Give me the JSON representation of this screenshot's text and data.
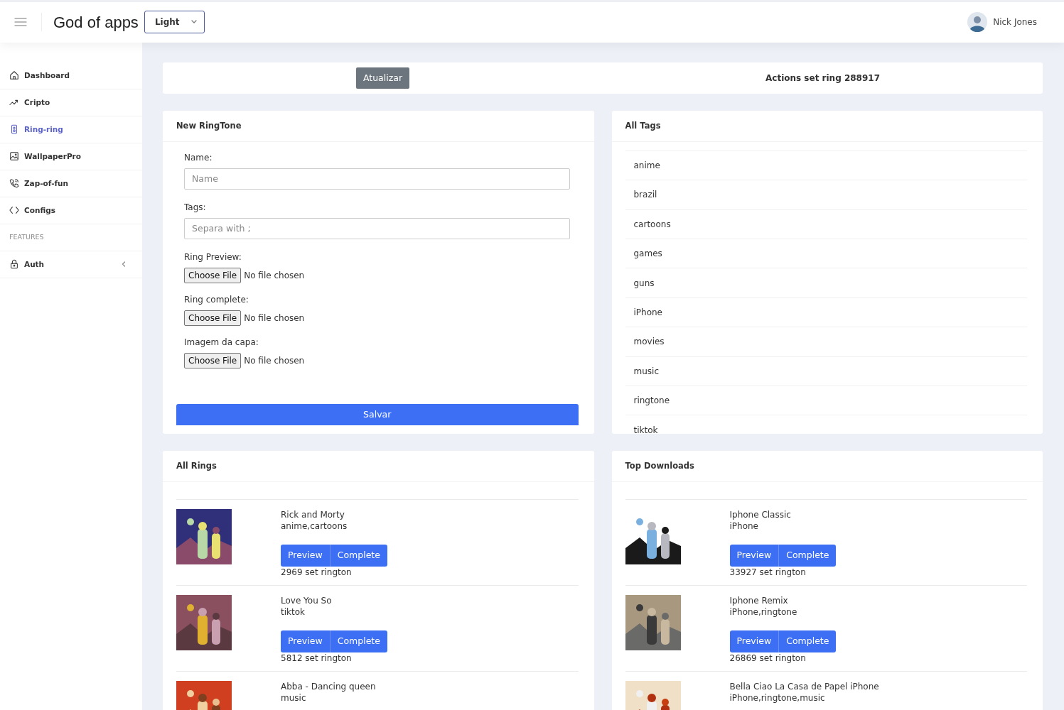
{
  "header": {
    "app_title": "God of apps",
    "theme_select": {
      "value": "Light"
    },
    "user": {
      "name": "Nick Jones"
    }
  },
  "sidebar": {
    "items": [
      {
        "label": "Dashboard",
        "selected": false
      },
      {
        "label": "Cripto",
        "selected": false
      },
      {
        "label": "Ring-ring",
        "selected": true
      },
      {
        "label": "WallpaperPro",
        "selected": false
      },
      {
        "label": "Zap-of-fun",
        "selected": false
      },
      {
        "label": "Configs",
        "selected": false
      }
    ],
    "section_title": "FEATURES",
    "section_items": [
      {
        "label": "Auth",
        "selected": false,
        "expanded": false
      }
    ]
  },
  "toolbar": {
    "button": "Atualizar",
    "title": "Actions set ring 288917"
  },
  "new_ringtone": {
    "title": "New RingTone",
    "fields": [
      {
        "kind": "text",
        "label": "Name:",
        "placeholder": "Name"
      },
      {
        "kind": "text",
        "label": "Tags:",
        "placeholder": "Separa with ;"
      },
      {
        "kind": "file",
        "label": "Ring Preview:",
        "button": "Choose File",
        "status": "No file chosen"
      },
      {
        "kind": "file",
        "label": "Ring complete:",
        "button": "Choose File",
        "status": "No file chosen"
      },
      {
        "kind": "file",
        "label": "Imagem da capa:",
        "button": "Choose File",
        "status": "No file chosen"
      }
    ],
    "submit": "Salvar"
  },
  "all_tags": {
    "title": "All Tags",
    "tags": [
      "anime",
      "brazil",
      "cartoons",
      "games",
      "guns",
      "iPhone",
      "movies",
      "music",
      "ringtone",
      "tiktok"
    ]
  },
  "all_rings": {
    "title": "All Rings",
    "items": [
      {
        "name": "Rick and Morty",
        "tags": "anime,cartoons",
        "buttons": [
          "Preview",
          "Complete"
        ],
        "count": "2969 set rington"
      },
      {
        "name": "Love You So",
        "tags": "tiktok",
        "buttons": [
          "Preview",
          "Complete"
        ],
        "count": "5812 set rington"
      },
      {
        "name": "Abba - Dancing queen",
        "tags": "music"
      }
    ]
  },
  "top_downloads": {
    "title": "Top Downloads",
    "items": [
      {
        "name": "Iphone Classic",
        "tags": "iPhone",
        "buttons": [
          "Preview",
          "Complete"
        ],
        "count": "33927 set rington"
      },
      {
        "name": "Iphone Remix",
        "tags": "iPhone,ringtone",
        "buttons": [
          "Preview",
          "Complete"
        ],
        "count": "26869 set rington"
      },
      {
        "name": "Bella Ciao La Casa de Papel iPhone",
        "tags": "iPhone,ringtone,music"
      }
    ]
  }
}
